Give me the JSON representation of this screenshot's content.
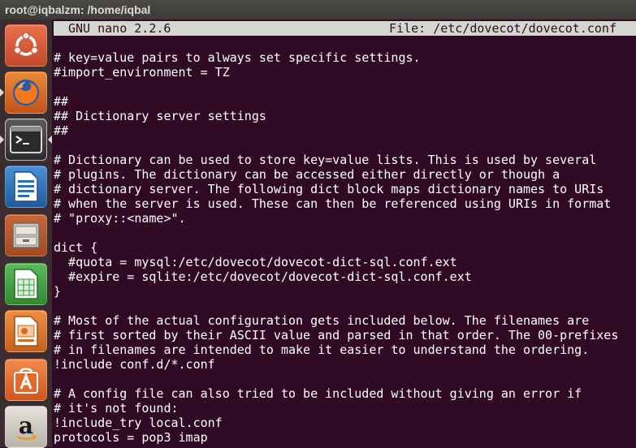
{
  "window": {
    "title": "root@iqbalzm: /home/iqbal"
  },
  "launcher": {
    "items": [
      {
        "name": "Dash home",
        "icon": "ubuntu-logo-icon",
        "color": "#d65a3a"
      },
      {
        "name": "Firefox Web Browser",
        "icon": "firefox-icon",
        "color": "#e96b1b"
      },
      {
        "name": "Terminal",
        "icon": "terminal-icon",
        "color": "#2c2c2c"
      },
      {
        "name": "LibreOffice Writer",
        "icon": "writer-document-icon",
        "color": "#2a6fb6"
      },
      {
        "name": "Files",
        "icon": "file-cabinet-icon",
        "color": "#9c9a95"
      },
      {
        "name": "LibreOffice Calc",
        "icon": "calc-spreadsheet-icon",
        "color": "#3a9a3a"
      },
      {
        "name": "LibreOffice Impress",
        "icon": "impress-presentation-icon",
        "color": "#d36b20"
      },
      {
        "name": "Ubuntu Software Center",
        "icon": "software-center-icon",
        "color": "#e46a2c"
      },
      {
        "name": "Amazon",
        "icon": "amazon-icon",
        "color": "#c8c4bc"
      }
    ]
  },
  "nano": {
    "version": "GNU nano 2.2.6",
    "file": "File: /etc/dovecot/dovecot.conf",
    "lines": [
      "# key=value pairs to always set specific settings.",
      "#import_environment = TZ",
      "",
      "##",
      "## Dictionary server settings",
      "##",
      "",
      "# Dictionary can be used to store key=value lists. This is used by several",
      "# plugins. The dictionary can be accessed either directly or though a",
      "# dictionary server. The following dict block maps dictionary names to URIs",
      "# when the server is used. These can then be referenced using URIs in format",
      "# \"proxy::<name>\".",
      "",
      "dict {",
      "  #quota = mysql:/etc/dovecot/dovecot-dict-sql.conf.ext",
      "  #expire = sqlite:/etc/dovecot/dovecot-dict-sql.conf.ext",
      "}",
      "",
      "# Most of the actual configuration gets included below. The filenames are",
      "# first sorted by their ASCII value and parsed in that order. The 00-prefixes",
      "# in filenames are intended to make it easier to understand the ordering.",
      "!include conf.d/*.conf",
      "",
      "# A config file can also tried to be included without giving an error if",
      "# it's not found:",
      "!include_try local.conf",
      "protocols = pop3 imap"
    ]
  }
}
